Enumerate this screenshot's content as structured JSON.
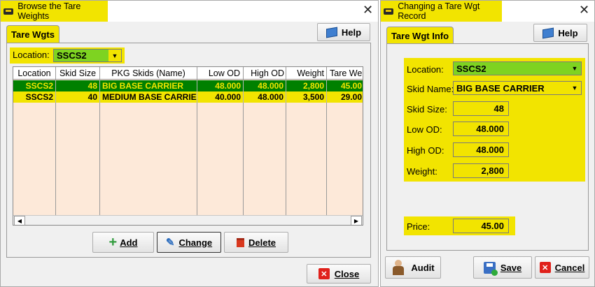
{
  "left_window": {
    "title": "Browse the Tare Weights",
    "tab_label": "Tare Wgts",
    "help_label": "Help",
    "location_label": "Location:",
    "location_value": "SSCS2",
    "columns": [
      "Location",
      "Skid Size",
      "PKG Skids (Name)",
      "Low OD",
      "High OD",
      "Weight",
      "Tare We"
    ],
    "rows": [
      [
        "SSCS2",
        "48",
        "BIG BASE CARRIER",
        "48.000",
        "48.000",
        "2,800",
        "45.00"
      ],
      [
        "SSCS2",
        "40",
        "MEDIUM BASE CARRIER",
        "40.000",
        "48.000",
        "3,500",
        "29.00"
      ]
    ],
    "add_label": "Add",
    "change_label": "Change",
    "delete_label": "Delete",
    "close_label": "Close"
  },
  "right_window": {
    "title": "Changing a Tare Wgt Record",
    "tab_label": "Tare Wgt Info",
    "help_label": "Help",
    "location_label": "Location:",
    "location_value": "SSCS2",
    "skid_name_label": "Skid Name:",
    "skid_name_value": "BIG BASE CARRIER",
    "skid_size_label": "Skid Size:",
    "skid_size_value": "48",
    "low_od_label": "Low OD:",
    "low_od_value": "48.000",
    "high_od_label": "High OD:",
    "high_od_value": "48.000",
    "weight_label": "Weight:",
    "weight_value": "2,800",
    "price_label": "Price:",
    "price_value": "45.00",
    "audit_label": "Audit",
    "save_label": "Save",
    "cancel_label": "Cancel"
  },
  "colors": {
    "highlight": "#f2e400",
    "selected_row": "#008000",
    "selected_combo": "#7ed321",
    "grid_background": "#fde9d9"
  }
}
